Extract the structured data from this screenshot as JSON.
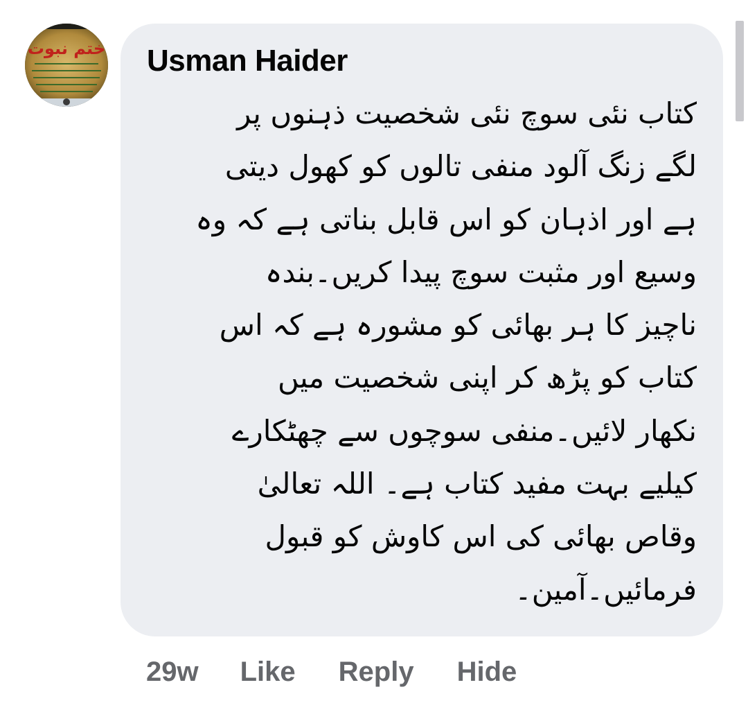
{
  "comment": {
    "author": "Usman Haider",
    "lines": [
      "کتاب نئی سوچ نئی شخصیت ذہنوں پر",
      "لگے زنگ آلود منفی تالوں کو کھول دیتی",
      "ہے اور اذہان کو اس قابل بناتی ہے کہ وہ",
      "وسیع اور مثبت سوچ پیدا کریں۔بندہ",
      "ناچیز کا ہر بھائی کو مشورہ ہے کہ اس",
      "کتاب کو پڑھ کر اپنی شخصیت میں",
      "نکھار لائیں۔منفی سوچوں سے چھٹکارے",
      "کیلیے بہت مفید کتاب ہے۔ اللہ تعالیٰ",
      "وقاص بھائی کی اس کاوش کو قبول",
      "فرمائیں۔آمین۔"
    ],
    "avatar": {
      "icon": "khatm-e-nabuwat-badge-icon",
      "title_text": "ختم نبوت"
    }
  },
  "actions": {
    "timestamp": "29w",
    "like_label": "Like",
    "reply_label": "Reply",
    "hide_label": "Hide"
  },
  "colors": {
    "bubble": "#eceef2",
    "text": "#050505",
    "secondary": "#65676b"
  }
}
